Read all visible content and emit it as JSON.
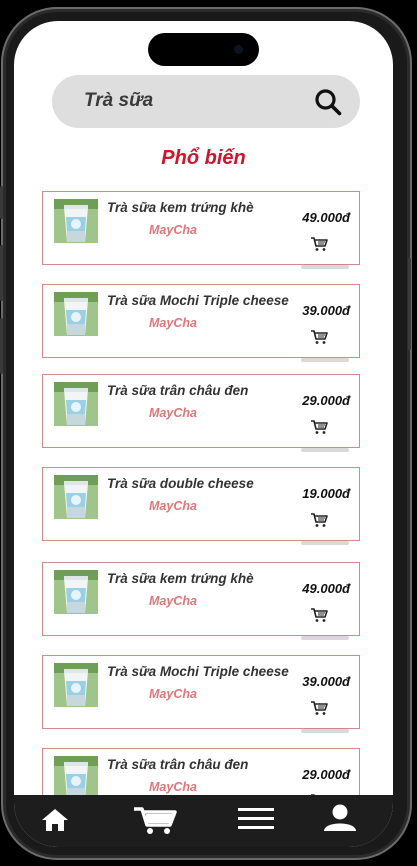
{
  "search": {
    "value": "Trà sữa"
  },
  "section": {
    "title": "Phổ biến"
  },
  "products": [
    {
      "name": "Trà sữa kem trứng khè",
      "brand": "MayCha",
      "price": "49.000đ"
    },
    {
      "name": "Trà sữa Mochi Triple cheese",
      "brand": "MayCha",
      "price": "39.000đ"
    },
    {
      "name": "Trà sữa  trân châu đen",
      "brand": "MayCha",
      "price": "29.000đ"
    },
    {
      "name": "Trà sữa  double cheese",
      "brand": "MayCha",
      "price": "19.000đ"
    },
    {
      "name": "Trà sữa kem trứng khè",
      "brand": "MayCha",
      "price": "49.000đ"
    },
    {
      "name": "Trà sữa Mochi Triple cheese",
      "brand": "MayCha",
      "price": "39.000đ"
    },
    {
      "name": "Trà sữa  trân châu đen",
      "brand": "MayCha",
      "price": "29.000đ"
    }
  ],
  "tabbar": {
    "icons": [
      "home-icon",
      "cart-icon",
      "menu-icon",
      "user-icon"
    ]
  },
  "colors": {
    "accent": "#d0142b",
    "brand": "#e0767a",
    "card_border": "#d58a8a",
    "tabbar": "#1d1d1d"
  }
}
